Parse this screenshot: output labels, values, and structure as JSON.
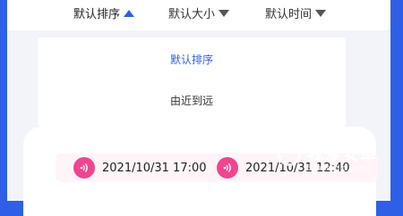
{
  "sort_bar": {
    "items": [
      {
        "label": "默认排序",
        "direction": "up",
        "active": true
      },
      {
        "label": "默认大小",
        "direction": "down",
        "active": false
      },
      {
        "label": "默认时间",
        "direction": "down",
        "active": false
      }
    ]
  },
  "dropdown": {
    "options": [
      {
        "label": "默认排序",
        "selected": true
      },
      {
        "label": "由近到远",
        "selected": false
      }
    ]
  },
  "records": [
    {
      "time": "2021/10/31 17:00",
      "icon": "audio-wave-icon"
    },
    {
      "time": "2021/10/31 12:40",
      "icon": "audio-wave-icon"
    }
  ],
  "watermark": {
    "title": "我爱安卓",
    "url": "52android.com"
  },
  "colors": {
    "accent": "#2f5fe6",
    "audio_icon": "#f0458f",
    "background": "#2f5fe6"
  }
}
